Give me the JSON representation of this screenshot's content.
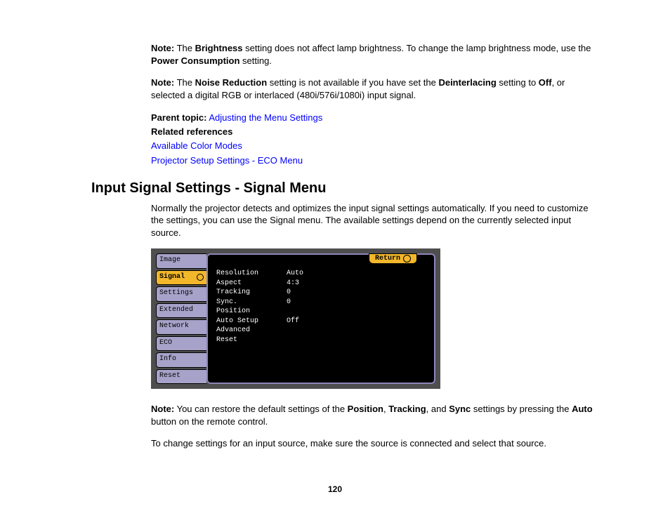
{
  "notes": {
    "note1": {
      "label": "Note:",
      "t1": " The ",
      "b1": "Brightness",
      "t2": " setting does not affect lamp brightness. To change the lamp brightness mode, use the ",
      "b2": "Power Consumption",
      "t3": " setting."
    },
    "note2": {
      "label": "Note:",
      "t1": " The ",
      "b1": "Noise Reduction",
      "t2": " setting is not available if you have set the ",
      "b2": "Deinterlacing",
      "t3": " setting to ",
      "b3": "Off",
      "t4": ", or selected a digital RGB or interlaced (480i/576i/1080i) input signal."
    },
    "note3": {
      "label": "Note:",
      "t1": " You can restore the default settings of the ",
      "b1": "Position",
      "t2": ", ",
      "b2": "Tracking",
      "t3": ", and ",
      "b3": "Sync",
      "t4": " settings by pressing the ",
      "b4": "Auto",
      "t5": " button on the remote control."
    }
  },
  "parent_topic": {
    "label": "Parent topic:",
    "link": "Adjusting the Menu Settings"
  },
  "related": {
    "label": "Related references",
    "link1": "Available Color Modes",
    "link2": "Projector Setup Settings - ECO Menu"
  },
  "heading": "Input Signal Settings - Signal Menu",
  "intro": "Normally the projector detects and optimizes the input signal settings automatically. If you need to customize the settings, you can use the Signal menu. The available settings depend on the currently selected input source.",
  "closing": "To change settings for an input source, make sure the source is connected and select that source.",
  "osd": {
    "tabs": [
      "Image",
      "Signal",
      "Settings",
      "Extended",
      "Network",
      "ECO",
      "Info",
      "Reset"
    ],
    "return": "Return",
    "rows": [
      {
        "k": "Resolution",
        "v": "Auto"
      },
      {
        "k": "Aspect",
        "v": "4:3"
      },
      {
        "k": "Tracking",
        "v": "   0"
      },
      {
        "k": "Sync.",
        "v": "   0"
      },
      {
        "k": "Position",
        "v": ""
      },
      {
        "k": "Auto Setup",
        "v": "Off"
      },
      {
        "k": "Advanced",
        "v": ""
      },
      {
        "k": "Reset",
        "v": ""
      }
    ]
  },
  "page_number": "120"
}
